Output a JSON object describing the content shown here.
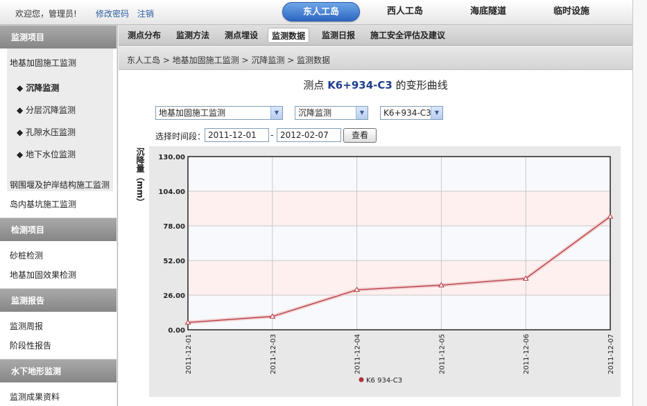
{
  "topbar": {
    "welcome": "欢迎您，管理员!",
    "change_password": "修改密码",
    "logout": "注销",
    "nav": [
      {
        "label": "东人工岛",
        "active": true
      },
      {
        "label": "西人工岛",
        "active": false
      },
      {
        "label": "海底隧道",
        "active": false
      },
      {
        "label": "临时设施",
        "active": false
      }
    ]
  },
  "sidebar": {
    "sections": [
      {
        "title": "监测项目"
      },
      {
        "title": "检测项目"
      },
      {
        "title": "监测报告"
      },
      {
        "title": "水下地形监测"
      }
    ],
    "monitor_items": {
      "group": "地基加固施工监测",
      "subitems": [
        "◆ 沉降监测",
        "◆ 分层沉降监测",
        "◆ 孔隙水压监测",
        "◆ 地下水位监测"
      ],
      "others": [
        "钢围堰及护岸结构施工监测",
        "岛内基坑施工监测"
      ]
    },
    "inspect_items": [
      "砂桩检测",
      "地基加固效果检测"
    ],
    "report_items": [
      "监测周报",
      "阶段性报告"
    ],
    "terrain_items": [
      "监测成果资料"
    ]
  },
  "tabs": [
    {
      "label": "测点分布",
      "active": false
    },
    {
      "label": "监测方法",
      "active": false
    },
    {
      "label": "测点埋设",
      "active": false
    },
    {
      "label": "监测数据",
      "active": true
    },
    {
      "label": "监测日报",
      "active": false
    },
    {
      "label": "施工安全评估及建议",
      "active": false
    }
  ],
  "breadcrumb": "东人工岛 > 地基加固施工监测 > 沉降监测 > 监测数据",
  "page": {
    "title_pre": "测点 ",
    "title_point": "K6+934-C3",
    "title_post": " 的变形曲线"
  },
  "filters": {
    "select1": "地基加固施工监测",
    "select2": "沉降监测",
    "select3": "K6+934-C3",
    "time_label": "选择时间段：",
    "start_date": "2011-12-01",
    "end_date": "2012-02-07",
    "dash": "-",
    "query_button": "查看"
  },
  "chart_data": {
    "type": "line",
    "ylabel": "沉降量（mm）",
    "ylim": [
      0,
      130
    ],
    "yticks": [
      "0.00",
      "26.00",
      "52.00",
      "78.00",
      "104.00",
      "130.00"
    ],
    "x": [
      "2011-12-01",
      "2011-12-03",
      "2011-12-04",
      "2011-12-05",
      "2011-12-06",
      "2011-12-07"
    ],
    "series": [
      {
        "name": "K6 934-C3",
        "values": [
          5.5,
          10,
          30,
          33.5,
          38.5,
          85
        ]
      }
    ],
    "grid": true,
    "legend": "bottom-center",
    "colors": {
      "line": "#b0303a",
      "band": "#fdf0ee",
      "plot_bg": "#f7f9fc",
      "frame": "#222222"
    }
  }
}
